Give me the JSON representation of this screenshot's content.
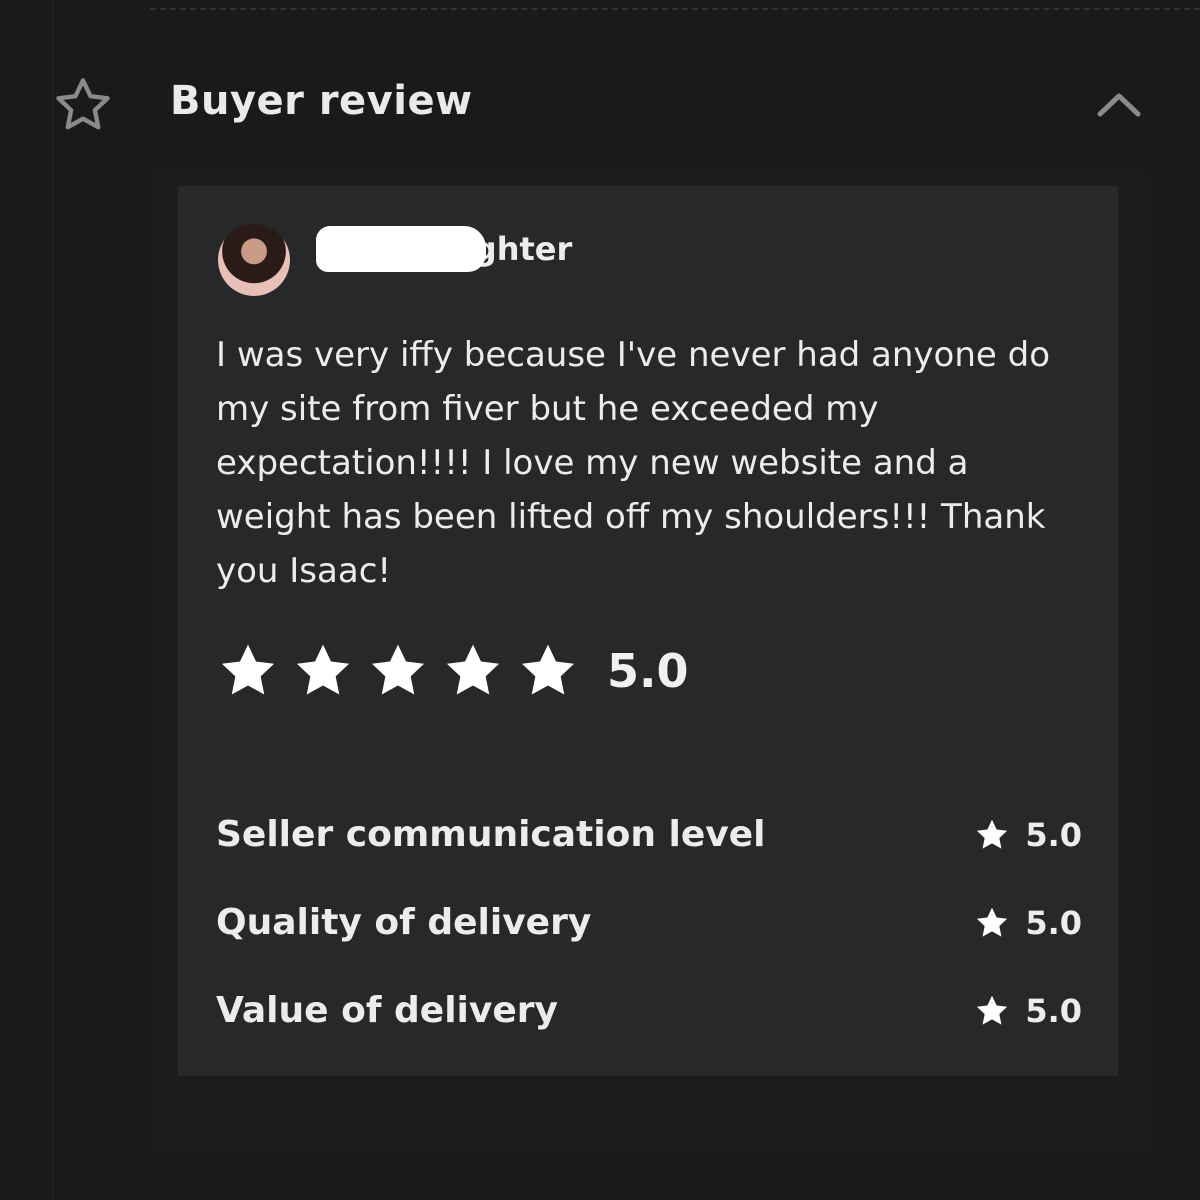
{
  "section": {
    "title": "Buyer review",
    "header_icon": "star-outline-icon",
    "toggle_icon": "chevron-up-icon"
  },
  "review": {
    "username_visible": "ighter",
    "text": "I was very iffy because I've never had anyone do my site from fiver but he exceeded my expectation!!!! I love my new website and a weight has been lifted off my shoulders!!! Thank you Isaac!",
    "rating": "5.0",
    "stars_filled": 5
  },
  "sub_ratings": [
    {
      "label": "Seller communication level",
      "value": "5.0"
    },
    {
      "label": "Quality of delivery",
      "value": "5.0"
    },
    {
      "label": "Value of delivery",
      "value": "5.0"
    }
  ],
  "colors": {
    "background": "#1a1a1b",
    "card": "#27282a",
    "text": "#ececec",
    "star": "#ffffff"
  }
}
